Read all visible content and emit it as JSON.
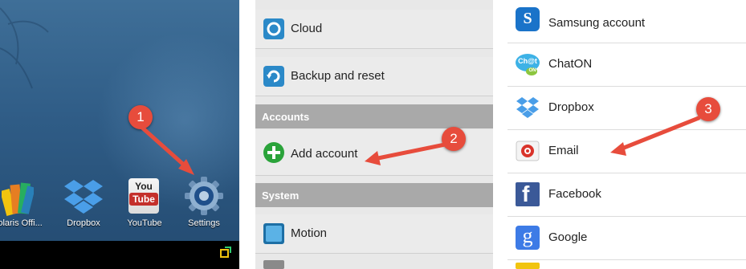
{
  "colors": {
    "accent_red": "#e74c3c",
    "section_header": "#a9a9a9"
  },
  "home": {
    "dock": [
      {
        "label": "Polaris Offi...",
        "icon": "polaris-office-icon"
      },
      {
        "label": "Dropbox",
        "icon": "dropbox-icon"
      },
      {
        "label": "YouTube",
        "icon": "youtube-icon"
      },
      {
        "label": "Settings",
        "icon": "settings-gear-icon"
      }
    ],
    "youtube_logo_top": "You",
    "youtube_logo_bottom": "Tube",
    "step_badge": "1"
  },
  "settings": {
    "items": [
      {
        "label": "Cloud",
        "icon": "cloud-icon"
      },
      {
        "label": "Backup and reset",
        "icon": "backup-icon"
      }
    ],
    "sections": [
      {
        "header": "Accounts",
        "items": [
          {
            "label": "Add account",
            "icon": "plus-icon"
          }
        ]
      },
      {
        "header": "System",
        "items": [
          {
            "label": "Motion",
            "icon": "motion-icon"
          }
        ]
      }
    ],
    "step_badge": "2"
  },
  "accounts": {
    "items": [
      {
        "label": "Samsung account",
        "icon": "samsung-icon"
      },
      {
        "label": "ChatON",
        "icon": "chaton-icon"
      },
      {
        "label": "Dropbox",
        "icon": "dropbox-icon"
      },
      {
        "label": "Email",
        "icon": "email-icon"
      },
      {
        "label": "Facebook",
        "icon": "facebook-icon"
      },
      {
        "label": "Google",
        "icon": "google-icon"
      }
    ],
    "chaton_logo_top": "Ch@t",
    "chaton_logo_bottom": "ON",
    "samsung_logo_letter": "S",
    "facebook_logo_letter": "f",
    "google_logo_letter": "g",
    "step_badge": "3"
  }
}
